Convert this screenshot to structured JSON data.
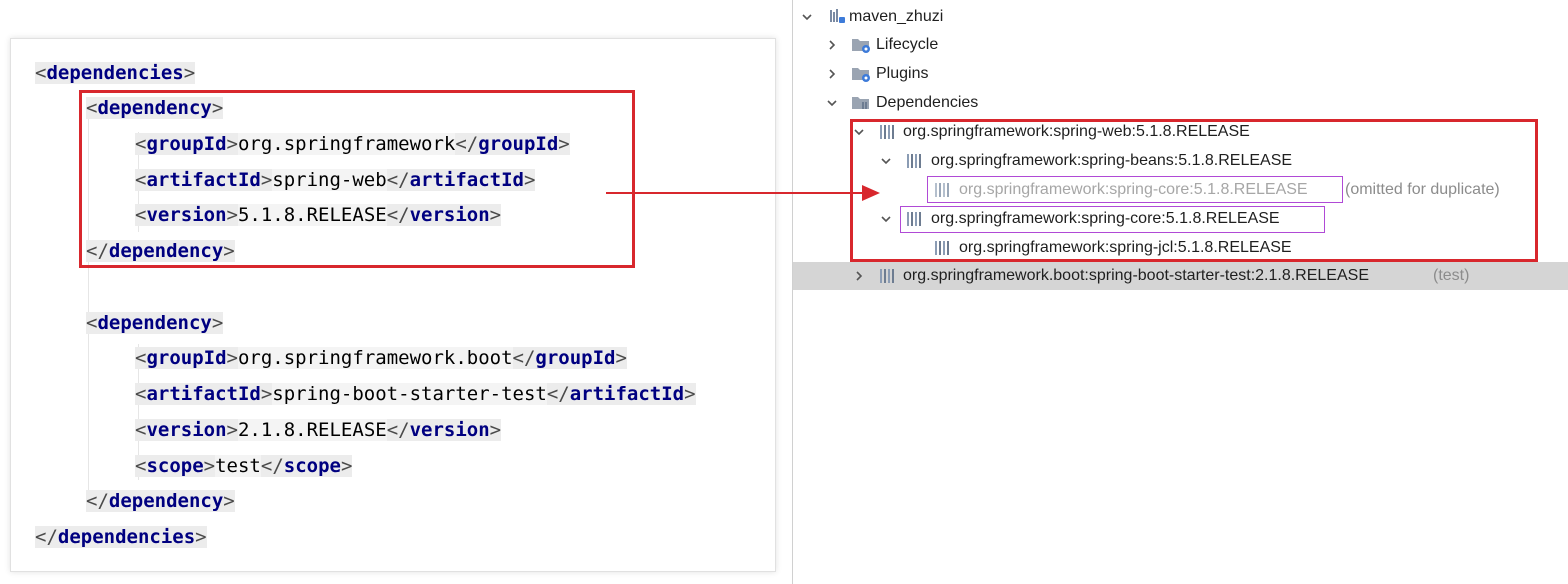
{
  "code": {
    "lines": [
      {
        "parts": [
          "<",
          "dependencies",
          ">"
        ]
      },
      {
        "parts": [
          "<",
          "dependency",
          ">"
        ]
      },
      {
        "parts": [
          "<",
          "groupId",
          ">",
          "org.springframework",
          "</",
          "groupId",
          ">"
        ]
      },
      {
        "parts": [
          "<",
          "artifactId",
          ">",
          "spring-web",
          "</",
          "artifactId",
          ">"
        ]
      },
      {
        "parts": [
          "<",
          "version",
          ">",
          "5.1.8.RELEASE",
          "</",
          "version",
          ">"
        ]
      },
      {
        "parts": [
          "</",
          "dependency",
          ">"
        ]
      },
      {
        "parts": [
          "<",
          "dependency",
          ">"
        ]
      },
      {
        "parts": [
          "<",
          "groupId",
          ">",
          "org.springframework.boot",
          "</",
          "groupId",
          ">"
        ]
      },
      {
        "parts": [
          "<",
          "artifactId",
          ">",
          "spring-boot-starter-test",
          "</",
          "artifactId",
          ">"
        ]
      },
      {
        "parts": [
          "<",
          "version",
          ">",
          "2.1.8.RELEASE",
          "</",
          "version",
          ">"
        ]
      },
      {
        "parts": [
          "<",
          "scope",
          ">",
          "test",
          "</",
          "scope",
          ">"
        ]
      },
      {
        "parts": [
          "</",
          "dependency",
          ">"
        ]
      },
      {
        "parts": [
          "</",
          "dependencies",
          ">"
        ]
      }
    ]
  },
  "tree": {
    "root": "maven_zhuzi",
    "lifecycle": "Lifecycle",
    "plugins": "Plugins",
    "dependencies": "Dependencies",
    "items": {
      "spring_web": "org.springframework:spring-web:5.1.8.RELEASE",
      "spring_beans": "org.springframework:spring-beans:5.1.8.RELEASE",
      "spring_core_omitted": "org.springframework:spring-core:5.1.8.RELEASE",
      "omitted_note": "(omitted for duplicate)",
      "spring_core": "org.springframework:spring-core:5.1.8.RELEASE",
      "spring_jcl": "org.springframework:spring-jcl:5.1.8.RELEASE",
      "boot_starter_test": "org.springframework.boot:spring-boot-starter-test:2.1.8.RELEASE",
      "test_scope": "(test)"
    }
  },
  "colors": {
    "annotation_red": "#d8272d",
    "annotation_purple": "#b04ad6",
    "xml_tag": "#000080",
    "selected_row": "#d5d5d5"
  },
  "icons": [
    "chevron-down-icon",
    "chevron-right-icon",
    "maven-project-icon",
    "folder-gear-icon",
    "library-icon",
    "arrow-icon"
  ]
}
